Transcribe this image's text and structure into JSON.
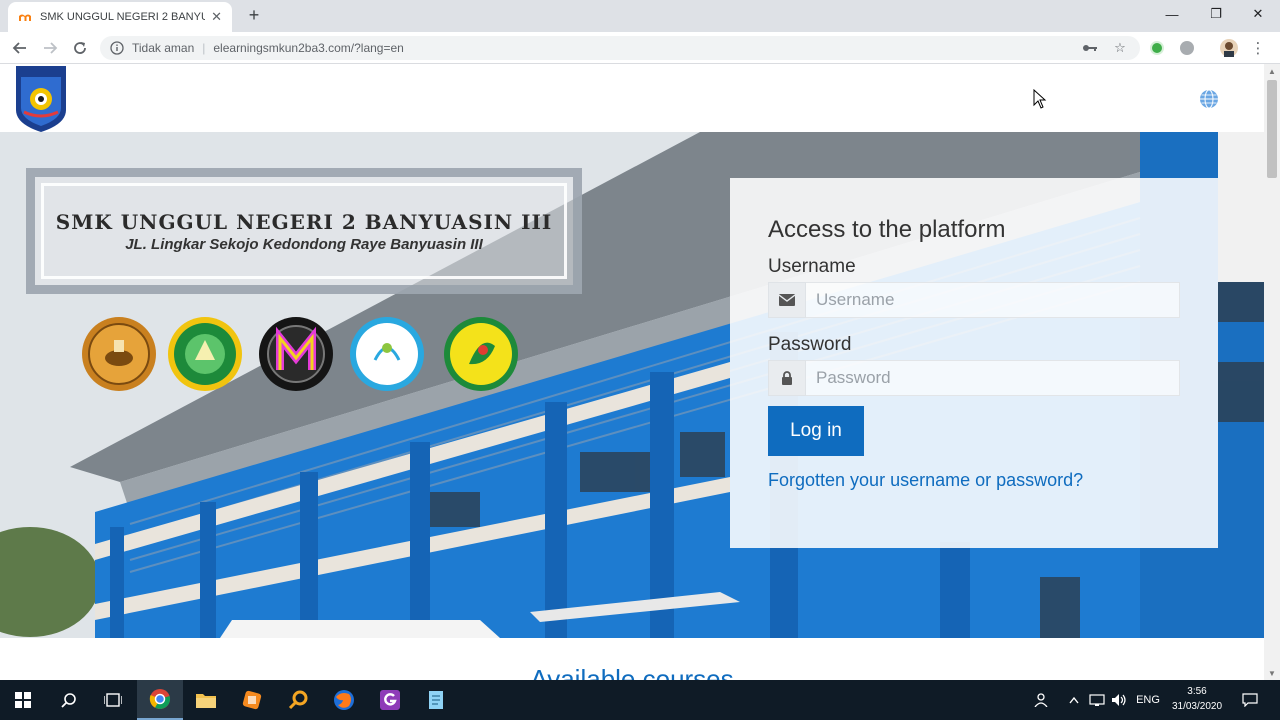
{
  "browser": {
    "tab_title": "SMK UNGGUL NEGERI 2 BANYUASIN III",
    "security_label": "Tidak aman",
    "url": "elearningsmkun2ba3.com/?lang=en"
  },
  "school": {
    "name": "SMK UNGGUL NEGERI 2 BANYUASIN III",
    "address": "JL. Lingkar Sekojo Kedondong Raye Banyuasin III"
  },
  "login": {
    "title": "Access to the platform",
    "username_label": "Username",
    "username_placeholder": "Username",
    "password_label": "Password",
    "password_placeholder": "Password",
    "login_button": "Log in",
    "forgot_link": "Forgotten your username or password?"
  },
  "main": {
    "courses_heading": "Available courses"
  },
  "taskbar": {
    "language": "ENG",
    "time": "3:56",
    "date": "31/03/2020"
  },
  "colors": {
    "accent": "#0f6cbf",
    "building_blue": "#1e7bd1",
    "taskbar": "#0f1b26"
  }
}
